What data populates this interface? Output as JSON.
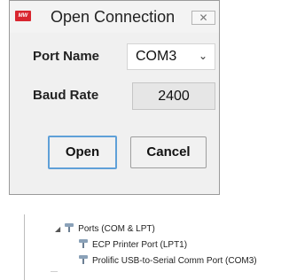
{
  "dialog": {
    "logo_text": "MW",
    "title": "Open Connection",
    "close_glyph": "✕",
    "port_label": "Port Name",
    "port_value": "COM3",
    "baud_label": "Baud Rate",
    "baud_value": "2400",
    "open_label": "Open",
    "cancel_label": "Cancel"
  },
  "device_tree": {
    "group_label": "Ports (COM & LPT)",
    "children": [
      "ECP Printer Port (LPT1)",
      "Prolific USB-to-Serial Comm Port (COM3)"
    ]
  },
  "colors": {
    "logo_red": "#d8262f",
    "focus_blue": "#5fa0d8"
  }
}
